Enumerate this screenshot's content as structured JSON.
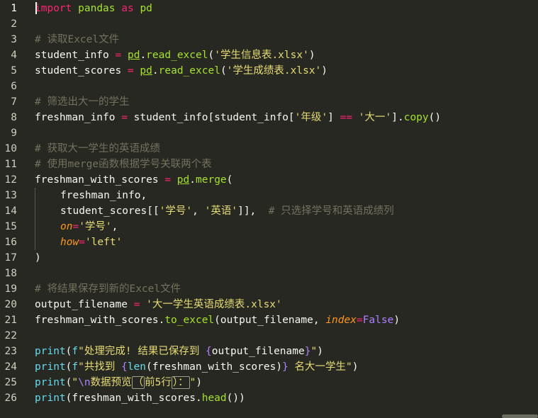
{
  "lines": [
    {
      "n": "1",
      "parts": [
        [
          "k",
          "import"
        ],
        [
          "t",
          " "
        ],
        [
          "f",
          "pandas"
        ],
        [
          "t",
          " "
        ],
        [
          "k",
          "as"
        ],
        [
          "t",
          " "
        ],
        [
          "f",
          "pd"
        ]
      ]
    },
    {
      "n": "2",
      "parts": []
    },
    {
      "n": "3",
      "parts": [
        [
          "c",
          "# 读取Excel文件"
        ]
      ]
    },
    {
      "n": "4",
      "parts": [
        [
          "t",
          "student_info "
        ],
        [
          "k",
          "="
        ],
        [
          "t",
          " "
        ],
        [
          "fu",
          "pd"
        ],
        [
          "t",
          "."
        ],
        [
          "f",
          "read_excel"
        ],
        [
          "t",
          "("
        ],
        [
          "s",
          "'学生信息表.xlsx'"
        ],
        [
          "t",
          ")"
        ]
      ]
    },
    {
      "n": "5",
      "parts": [
        [
          "t",
          "student_scores "
        ],
        [
          "k",
          "="
        ],
        [
          "t",
          " "
        ],
        [
          "fu",
          "pd"
        ],
        [
          "t",
          "."
        ],
        [
          "f",
          "read_excel"
        ],
        [
          "t",
          "("
        ],
        [
          "s",
          "'学生成绩表.xlsx'"
        ],
        [
          "t",
          ")"
        ]
      ]
    },
    {
      "n": "6",
      "parts": []
    },
    {
      "n": "7",
      "parts": [
        [
          "c",
          "# 筛选出大一的学生"
        ]
      ]
    },
    {
      "n": "8",
      "parts": [
        [
          "t",
          "freshman_info "
        ],
        [
          "k",
          "="
        ],
        [
          "t",
          " student_info[student_info["
        ],
        [
          "s",
          "'年级'"
        ],
        [
          "t",
          "] "
        ],
        [
          "k",
          "=="
        ],
        [
          "t",
          " "
        ],
        [
          "s",
          "'大一'"
        ],
        [
          "t",
          "]."
        ],
        [
          "f",
          "copy"
        ],
        [
          "t",
          "()"
        ]
      ]
    },
    {
      "n": "9",
      "parts": []
    },
    {
      "n": "10",
      "parts": [
        [
          "c",
          "# 获取大一学生的英语成绩"
        ]
      ]
    },
    {
      "n": "11",
      "parts": [
        [
          "c",
          "# 使用merge函数根据学号关联两个表"
        ]
      ]
    },
    {
      "n": "12",
      "parts": [
        [
          "t",
          "freshman_with_scores "
        ],
        [
          "k",
          "="
        ],
        [
          "t",
          " "
        ],
        [
          "fu",
          "pd"
        ],
        [
          "t",
          "."
        ],
        [
          "f",
          "merge"
        ],
        [
          "t",
          "("
        ]
      ]
    },
    {
      "n": "13",
      "indent": true,
      "parts": [
        [
          "t",
          "freshman_info,"
        ]
      ]
    },
    {
      "n": "14",
      "indent": true,
      "parts": [
        [
          "t",
          "student_scores[["
        ],
        [
          "s",
          "'学号'"
        ],
        [
          "t",
          ", "
        ],
        [
          "s",
          "'英语'"
        ],
        [
          "t",
          "]],  "
        ],
        [
          "c",
          "# 只选择学号和英语成绩列"
        ]
      ]
    },
    {
      "n": "15",
      "indent": true,
      "parts": [
        [
          "p",
          "on"
        ],
        [
          "k",
          "="
        ],
        [
          "s",
          "'学号'"
        ],
        [
          "t",
          ","
        ]
      ]
    },
    {
      "n": "16",
      "indent": true,
      "parts": [
        [
          "p",
          "how"
        ],
        [
          "k",
          "="
        ],
        [
          "s",
          "'left'"
        ]
      ]
    },
    {
      "n": "17",
      "parts": [
        [
          "t",
          ")"
        ]
      ]
    },
    {
      "n": "18",
      "parts": []
    },
    {
      "n": "19",
      "parts": [
        [
          "c",
          "# 将结果保存到新的Excel文件"
        ]
      ]
    },
    {
      "n": "20",
      "parts": [
        [
          "t",
          "output_filename "
        ],
        [
          "k",
          "="
        ],
        [
          "t",
          " "
        ],
        [
          "s",
          "'大一学生英语成绩表.xlsx'"
        ]
      ]
    },
    {
      "n": "21",
      "parts": [
        [
          "t",
          "freshman_with_scores."
        ],
        [
          "f",
          "to_excel"
        ],
        [
          "t",
          "(output_filename, "
        ],
        [
          "p",
          "index"
        ],
        [
          "k",
          "="
        ],
        [
          "cst",
          "False"
        ],
        [
          "t",
          ")"
        ]
      ]
    },
    {
      "n": "22",
      "parts": []
    },
    {
      "n": "23",
      "parts": [
        [
          "b",
          "print"
        ],
        [
          "t",
          "("
        ],
        [
          "b",
          "f"
        ],
        [
          "s",
          "\"处理完成! 结果已保存到 "
        ],
        [
          "sp",
          "{"
        ],
        [
          "ph",
          "output_filename"
        ],
        [
          "sp",
          "}"
        ],
        [
          "s",
          "\""
        ],
        [
          "t",
          ")"
        ]
      ]
    },
    {
      "n": "24",
      "parts": [
        [
          "b",
          "print"
        ],
        [
          "t",
          "("
        ],
        [
          "b",
          "f"
        ],
        [
          "s",
          "\"共找到 "
        ],
        [
          "sp",
          "{"
        ],
        [
          "b",
          "len"
        ],
        [
          "ph",
          "(freshman_with_scores)"
        ],
        [
          "sp",
          "}"
        ],
        [
          "s",
          " 名大一学生\""
        ],
        [
          "t",
          ")"
        ]
      ]
    },
    {
      "n": "25",
      "parts": [
        [
          "b",
          "print"
        ],
        [
          "t",
          "("
        ],
        [
          "s",
          "\""
        ],
        [
          "cst",
          "\\n"
        ],
        [
          "s",
          "数据预览"
        ],
        [
          "sbox",
          "（"
        ],
        [
          "s",
          "前5行"
        ],
        [
          "sbox",
          "）："
        ],
        [
          "s",
          "\""
        ],
        [
          "t",
          ")"
        ]
      ]
    },
    {
      "n": "26",
      "parts": [
        [
          "b",
          "print"
        ],
        [
          "t",
          "(freshman_with_scores."
        ],
        [
          "f",
          "head"
        ],
        [
          "t",
          "())"
        ]
      ]
    }
  ]
}
